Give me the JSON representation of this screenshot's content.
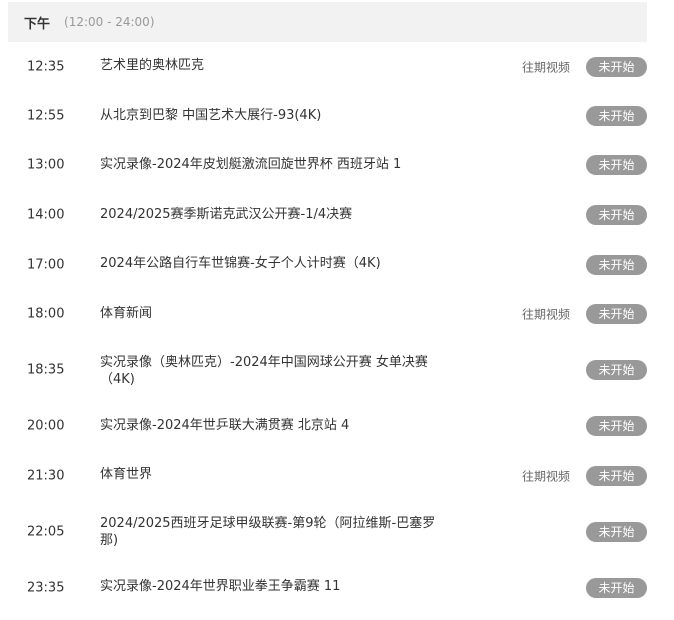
{
  "header": {
    "title": "下午",
    "range": "(12:00 - 24:00)"
  },
  "programs": [
    {
      "time": "12:35",
      "title": "艺术里的奥林匹克",
      "past": "往期视频",
      "status": "未开始"
    },
    {
      "time": "12:55",
      "title": "从北京到巴黎 中国艺术大展行-93(4K)",
      "past": "",
      "status": "未开始"
    },
    {
      "time": "13:00",
      "title": "实况录像-2024年皮划艇激流回旋世界杯 西班牙站 1",
      "past": "",
      "status": "未开始"
    },
    {
      "time": "14:00",
      "title": "2024/2025赛季斯诺克武汉公开赛-1/4决赛",
      "past": "",
      "status": "未开始"
    },
    {
      "time": "17:00",
      "title": "2024年公路自行车世锦赛-女子个人计时赛（4K)",
      "past": "",
      "status": "未开始"
    },
    {
      "time": "18:00",
      "title": "体育新闻",
      "past": "往期视频",
      "status": "未开始"
    },
    {
      "time": "18:35",
      "title": "实况录像（奥林匹克）-2024年中国网球公开赛 女单决赛（4K)",
      "past": "",
      "status": "未开始"
    },
    {
      "time": "20:00",
      "title": "实况录像-2024年世乒联大满贯赛 北京站 4",
      "past": "",
      "status": "未开始"
    },
    {
      "time": "21:30",
      "title": "体育世界",
      "past": "往期视频",
      "status": "未开始"
    },
    {
      "time": "22:05",
      "title": "2024/2025西班牙足球甲级联赛-第9轮（阿拉维斯-巴塞罗那)",
      "past": "",
      "status": "未开始"
    },
    {
      "time": "23:35",
      "title": "实况录像-2024年世界职业拳王争霸赛 11",
      "past": "",
      "status": "未开始"
    }
  ]
}
